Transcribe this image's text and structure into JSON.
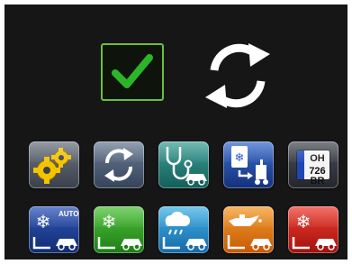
{
  "status": {
    "checkmark_icon": "check-icon",
    "sync_icon": "sync-icon"
  },
  "colors": {
    "background": "#161616",
    "check_green": "#6cbf3a"
  },
  "tiles_row1": [
    {
      "id": "settings",
      "icon": "gears-icon"
    },
    {
      "id": "sync",
      "icon": "sync-icon"
    },
    {
      "id": "diagnostics",
      "icon": "stethoscope-car-icon"
    },
    {
      "id": "ac-service",
      "icon": "ac-service-unit-icon"
    },
    {
      "id": "license-plate",
      "icon": "license-plate-icon"
    }
  ],
  "plate": {
    "country": "",
    "line1": "OH",
    "line2": "726 BR"
  },
  "tiles_row2": [
    {
      "id": "auto-ac",
      "icon": "auto-climate-icon",
      "label": "AUTO"
    },
    {
      "id": "ac-green",
      "icon": "snowflake-car-icon"
    },
    {
      "id": "leak-test",
      "icon": "cloud-drops-car-icon"
    },
    {
      "id": "oil",
      "icon": "oil-can-car-icon"
    },
    {
      "id": "ac-red",
      "icon": "snowflake-car-icon"
    }
  ]
}
